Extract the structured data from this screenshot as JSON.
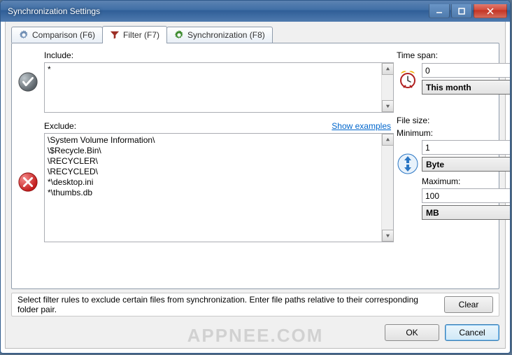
{
  "window": {
    "title": "Synchronization Settings"
  },
  "tabs": [
    {
      "label": "Comparison (F6)"
    },
    {
      "label": "Filter (F7)"
    },
    {
      "label": "Synchronization (F8)"
    }
  ],
  "include": {
    "label": "Include:",
    "value": "*"
  },
  "exclude": {
    "label": "Exclude:",
    "show_examples": "Show examples",
    "value": "\\System Volume Information\\\n\\$Recycle.Bin\\\n\\RECYCLER\\\n\\RECYCLED\\\n*\\desktop.ini\n*\\thumbs.db"
  },
  "timespan": {
    "label": "Time span:",
    "value": "0",
    "unit": "This month"
  },
  "filesize": {
    "label": "File size:",
    "min_label": "Minimum:",
    "min_value": "1",
    "min_unit": "Byte",
    "max_label": "Maximum:",
    "max_value": "100",
    "max_unit": "MB"
  },
  "hint": "Select filter rules to exclude certain files from synchronization. Enter file paths relative to their corresponding folder pair.",
  "buttons": {
    "clear": "Clear",
    "ok": "OK",
    "cancel": "Cancel"
  },
  "watermark": "APPNEE.COM"
}
